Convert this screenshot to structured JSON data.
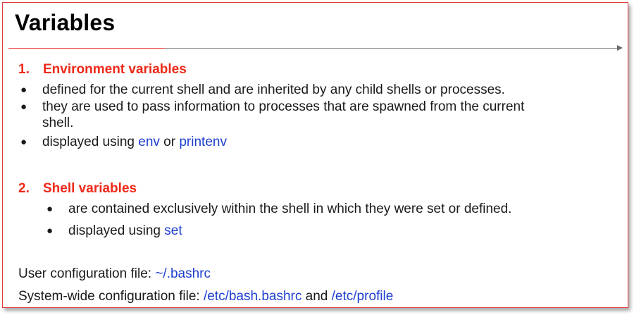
{
  "title": "Variables",
  "section1": {
    "number": "1.",
    "heading": "Environment variables",
    "bullet1": "defined for the current shell and are inherited by any child shells or processes.",
    "bullet2_line1": "they are used to pass information to processes that are spawned from the current",
    "bullet2_line2": "shell.",
    "bullet3_prefix": "displayed using ",
    "bullet3_cmd1": "env",
    "bullet3_or": " or ",
    "bullet3_cmd2": "printenv"
  },
  "section2": {
    "number": "2.",
    "heading": "Shell variables",
    "bullet1": "are contained exclusively within the shell in which they were set or defined.",
    "bullet2_prefix": "displayed using ",
    "bullet2_cmd": "set"
  },
  "config": {
    "user_label": "User configuration file: ",
    "user_file": "~/.bashrc",
    "system_label": "System-wide configuration file: ",
    "system_file1": "/etc/bash.bashrc",
    "system_and": " and ",
    "system_file2": "/etc/profile"
  },
  "bullet_glyph": "●",
  "colors": {
    "heading": "#ee2a1a",
    "command": "#1c3fcf",
    "border": "#e23b3b"
  }
}
